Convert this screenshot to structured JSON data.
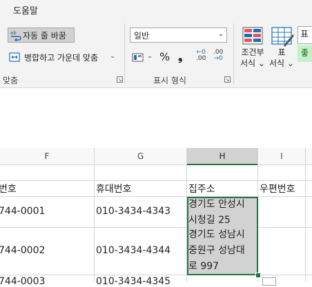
{
  "ribbon": {
    "tab_label": "도움말",
    "wrap_text_label": "자동 줄 바꿈",
    "merge_center_label": "병합하고 가운데 맞춤",
    "alignment_group_label": "맞춤",
    "number_format_value": "일반",
    "percent_symbol": "%",
    "comma_symbol": "❟",
    "increase_decimal_top": "←0",
    "increase_decimal_bottom": ".00",
    "decrease_decimal_top": ".00",
    "decrease_decimal_bottom": "→0",
    "number_group_label": "표시 형식",
    "conditional_format_label_1": "조건부",
    "conditional_format_label_2": "서식 ⌄",
    "format_table_label_1": "표",
    "format_table_label_2": "서식 ⌄",
    "style_normal_label": "표",
    "style_good_label": "좋"
  },
  "sheet": {
    "columns": [
      "F",
      "G",
      "H",
      "I"
    ],
    "selected_column": "H",
    "header_row": {
      "f": "번호",
      "g": "휴대번호",
      "h": "집주소",
      "i": "우편번호"
    },
    "rows": [
      {
        "f": "744-0001",
        "g": "010-3434-4343",
        "h_line1": "경기도 안성시",
        "h_line2": "시청길 25",
        "h_line3": ""
      },
      {
        "f": "744-0002",
        "g": "010-3434-4344",
        "h_line1": "경기도 성남시",
        "h_line2": "중원구 성남대",
        "h_line3": "로 997"
      },
      {
        "f": "744-0003",
        "g": "010-3434-4345",
        "h_line1": "",
        "h_line2": "",
        "h_line3": ""
      }
    ]
  },
  "colors": {
    "selection_border": "#217346",
    "selection_fill": "#d2d2d2",
    "ribbon_bg": "#f3f3f3",
    "good_style_bg": "#c6efce",
    "good_style_fg": "#006100"
  }
}
